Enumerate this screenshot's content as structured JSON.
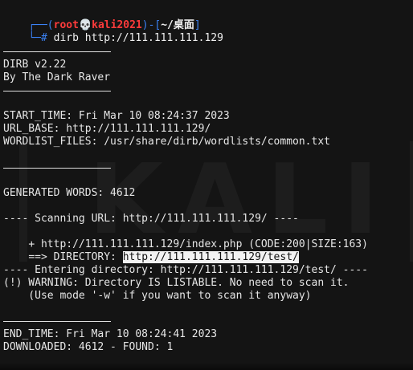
{
  "prompt": {
    "open": "┌──(",
    "user": "root",
    "skull": "💀",
    "host": "kali2021",
    "close": ")-[",
    "path": "~/桌面",
    "end": "]",
    "hash": "└─#",
    "command": " dirb http://111.111.111.129"
  },
  "banner": {
    "name": "DIRB v2.22",
    "author": "By The Dark Raver"
  },
  "info": {
    "start_time": "START_TIME: Fri Mar 10 08:24:37 2023",
    "url_base": "URL_BASE: http://111.111.111.129/",
    "wordlist": "WORDLIST_FILES: /usr/share/dirb/wordlists/common.txt"
  },
  "generated": "GENERATED WORDS: 4612",
  "scan": {
    "scanning": "---- Scanning URL: http://111.111.111.129/ ----",
    "found_prefix": "+ http://111.111.111.129/index.php (CODE:200",
    "found_bar": "|",
    "found_suffix": "SIZE:163)",
    "dir_prefix": "==> DIRECTORY: ",
    "dir_url": "http://111.111.111.129/test/",
    "entering": "---- Entering directory: http://111.111.111.129/test/ ----",
    "warning": "(!) WARNING: Directory IS LISTABLE. No need to scan it.",
    "hint": "    (Use mode '-w' if you want to scan it anyway)"
  },
  "end": {
    "end_time": "END_TIME: Fri Mar 10 08:24:41 2023",
    "downloaded": "DOWNLOADED: 4612 - FOUND: 1"
  },
  "watermark": "KALI",
  "colors": {
    "prompt": "#3b82f6",
    "user": "#ff3b3b",
    "background": "#141414",
    "text": "#e6e6e6"
  }
}
